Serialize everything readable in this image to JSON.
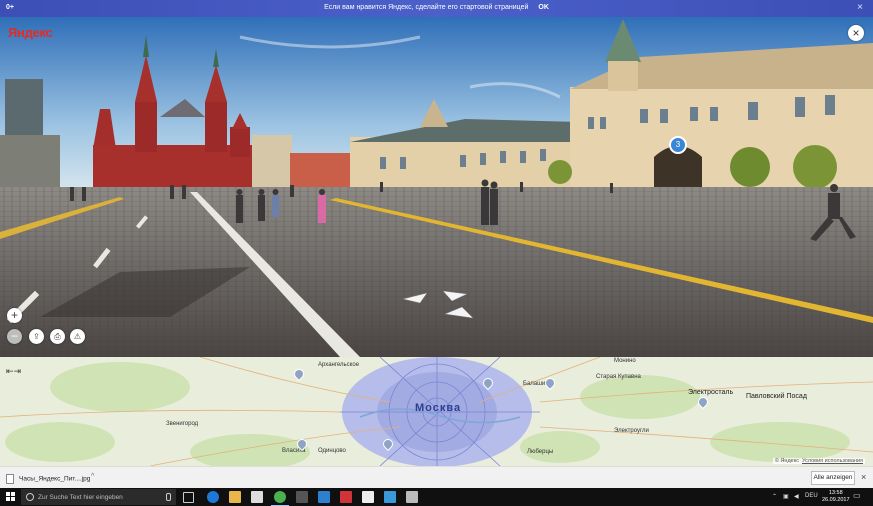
{
  "banner": {
    "age_rating": "0+",
    "message": "Если вам нравится Яндекс, сделайте его стартовой страницей",
    "ok_label": "OK",
    "close_glyph": "×"
  },
  "panorama": {
    "logo": "Яндекс",
    "close_glyph": "×",
    "zoom_in": "+",
    "zoom_out": "−",
    "marker_number": "3"
  },
  "map": {
    "expand_glyph": "⇤⇥",
    "city_label": "Москва",
    "labels": [
      {
        "text": "Архангельское"
      },
      {
        "text": "Звенигород"
      },
      {
        "text": "Одинцово"
      },
      {
        "text": "Власиха"
      },
      {
        "text": "Монино"
      },
      {
        "text": "Старая Купавна"
      },
      {
        "text": "Балашиха"
      },
      {
        "text": "Электросталь"
      },
      {
        "text": "Павловский Посад"
      },
      {
        "text": "Электроугли"
      },
      {
        "text": "Люберцы"
      }
    ],
    "copyright": "© Яндекс",
    "terms_link": "Условия использования"
  },
  "download_bar": {
    "file_name": "Часы_Яндекс_Пит....jpg",
    "chevron": "^",
    "show_all": "Alle anzeigen",
    "close_glyph": "×"
  },
  "taskbar": {
    "search_placeholder": "Zur Suche Text hier eingeben",
    "language": "DEU",
    "time": "13:58",
    "date": "26.09.2017"
  },
  "colors": {
    "banner": "#4256c0",
    "yandex_red": "#e62a24",
    "marker_blue": "#3a86d6",
    "taskbar": "#101010"
  }
}
